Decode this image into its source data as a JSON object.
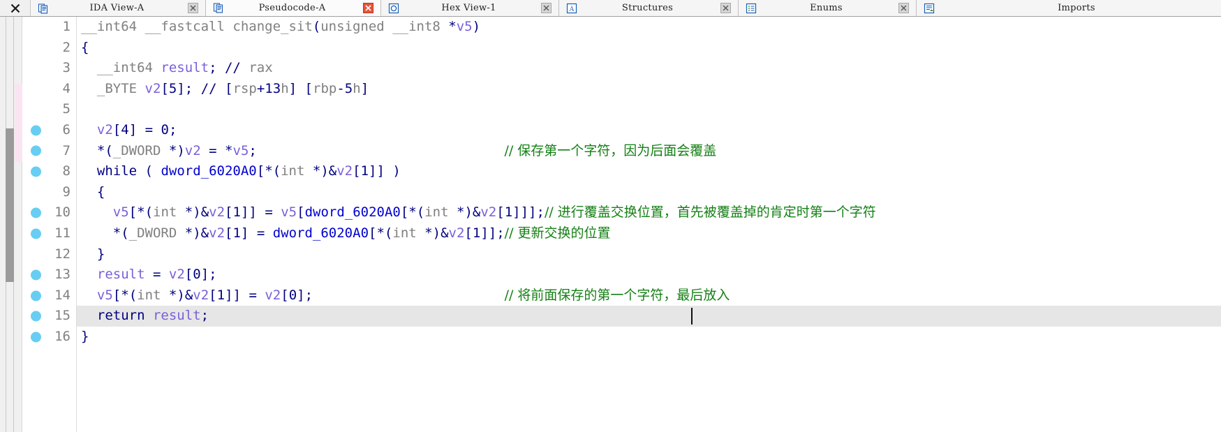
{
  "window": {
    "close_label": "✕"
  },
  "tabs": [
    {
      "label": "IDA View-A",
      "icon": "document-icon",
      "active": false,
      "close": "close-icon"
    },
    {
      "label": "Pseudocode-A",
      "icon": "document-icon",
      "active": true,
      "close": "close-icon"
    },
    {
      "label": "Hex View-1",
      "icon": "hexview-icon",
      "active": false,
      "close": "close-icon"
    },
    {
      "label": "Structures",
      "icon": "structures-icon",
      "active": false,
      "close": "close-icon"
    },
    {
      "label": "Enums",
      "icon": "enums-icon",
      "active": false,
      "close": "close-icon"
    },
    {
      "label": "Imports",
      "icon": "imports-icon",
      "active": false,
      "close": "close-icon"
    }
  ],
  "colors": {
    "keyword": "#00007f",
    "type": "#808080",
    "local_var": "#7a5fd9",
    "global_var": "#0000cf",
    "comment": "#158015",
    "breakpoint": "#68cdf2",
    "highlight_row": "#e6e6e6"
  },
  "code": {
    "lines": [
      {
        "n": "1",
        "bp": false,
        "hl": false,
        "text": "__int64 __fastcall change_sit(unsigned __int8 *v5)"
      },
      {
        "n": "2",
        "bp": false,
        "hl": false,
        "text": "{"
      },
      {
        "n": "3",
        "bp": false,
        "hl": false,
        "text": "  __int64 result; // rax"
      },
      {
        "n": "4",
        "bp": false,
        "hl": false,
        "text": "  _BYTE v2[5]; // [rsp+13h] [rbp-5h]"
      },
      {
        "n": "5",
        "bp": false,
        "hl": false,
        "text": ""
      },
      {
        "n": "6",
        "bp": true,
        "hl": false,
        "text": "  v2[4] = 0;"
      },
      {
        "n": "7",
        "bp": true,
        "hl": false,
        "text": "  *(_DWORD *)v2 = *v5;",
        "comment": "// 保存第一个字符，因为后面会覆盖"
      },
      {
        "n": "8",
        "bp": true,
        "hl": false,
        "text": "  while ( dword_6020A0[*(int *)&v2[1]] )"
      },
      {
        "n": "9",
        "bp": false,
        "hl": false,
        "text": "  {"
      },
      {
        "n": "10",
        "bp": true,
        "hl": false,
        "text": "    v5[*(int *)&v2[1]] = v5[dword_6020A0[*(int *)&v2[1]]];",
        "comment": "// 进行覆盖交换位置，首先被覆盖掉的肯定时第一个字符"
      },
      {
        "n": "11",
        "bp": true,
        "hl": false,
        "text": "    *(_DWORD *)&v2[1] = dword_6020A0[*(int *)&v2[1]];",
        "comment": "// 更新交换的位置"
      },
      {
        "n": "12",
        "bp": false,
        "hl": false,
        "text": "  }"
      },
      {
        "n": "13",
        "bp": true,
        "hl": false,
        "text": "  result = v2[0];"
      },
      {
        "n": "14",
        "bp": true,
        "hl": false,
        "text": "  v5[*(int *)&v2[1]] = v2[0];",
        "comment": "// 将前面保存的第一个字符，最后放入"
      },
      {
        "n": "15",
        "bp": true,
        "hl": true,
        "text": "  return result;"
      },
      {
        "n": "16",
        "bp": true,
        "hl": false,
        "text": "}"
      }
    ]
  }
}
